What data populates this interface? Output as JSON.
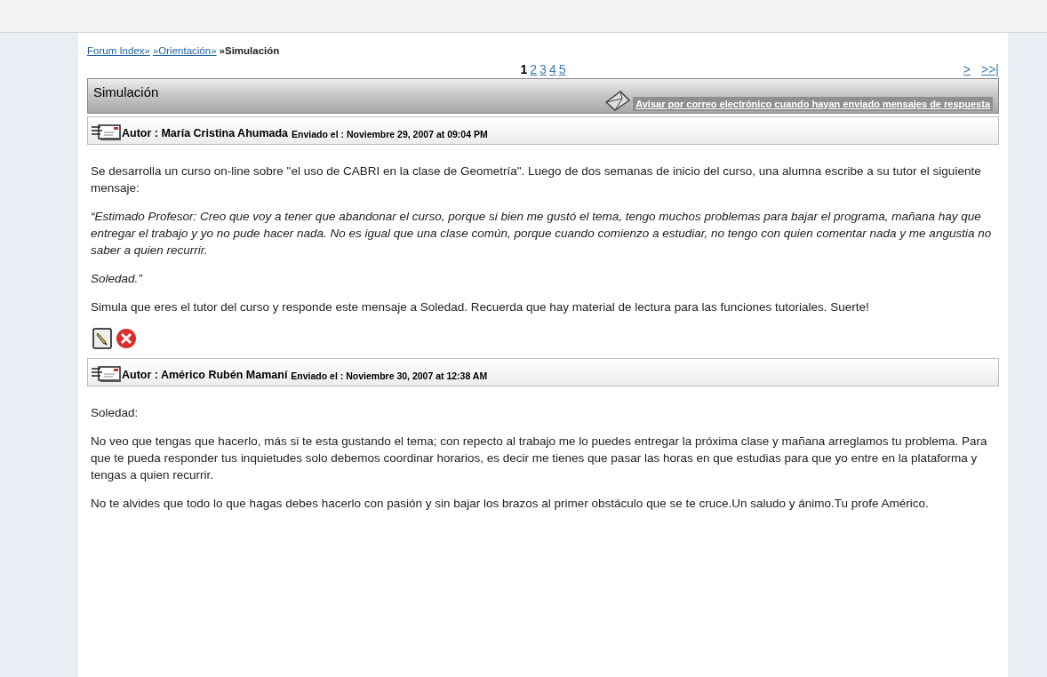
{
  "breadcrumb": [
    {
      "kind": "link",
      "text": "Forum Index»"
    },
    {
      "kind": "link",
      "text": "»Orientación»"
    },
    {
      "kind": "current",
      "text": "»Simulación"
    }
  ],
  "pagination": {
    "pages": [
      {
        "label": "1",
        "selected": true
      },
      {
        "label": "2",
        "selected": false
      },
      {
        "label": "3",
        "selected": false
      },
      {
        "label": "4",
        "selected": false
      },
      {
        "label": "5",
        "selected": false
      }
    ],
    "next": ">",
    "last": ">>|"
  },
  "topic": {
    "title": "Simulación",
    "notify_link": "Avisar por correo electrónico cuando hayan enviado mensajes de respuesta"
  },
  "posts": [
    {
      "author": "Autor : María Cristina Ahumada",
      "sent": "Enviado el : Noviembre 29, 2007 at 09:04 PM",
      "actions": true,
      "paragraphs": [
        {
          "kind": "normal",
          "text": "Se desarrolla un curso on-line sobre \"el uso de CABRI en la clase de Geometría\". Luego de dos semanas de inicio del curso, una alumna escribe a su tutor el siguiente mensaje:"
        },
        {
          "kind": "italic",
          "text": "“Estimado Profesor: Creo que voy a tener que abandonar el curso, porque si bien me gustó el tema, tengo muchos problemas para bajar el programa, mañana hay que entregar el trabajo y yo no pude hacer nada. No es igual que una clase común, porque cuando comienzo a estudiar, no tengo con quien comentar nada y me angustia no saber a quien recurrir."
        },
        {
          "kind": "italic",
          "text": "Soledad.”"
        },
        {
          "kind": "normal",
          "text": "Simula que eres el tutor del curso y responde este mensaje a Soledad. Recuerda que hay material de lectura para las funciones tutoriales. Suerte!"
        }
      ]
    },
    {
      "author": "Autor : Américo Rubén Mamaní",
      "sent": "Enviado el : Noviembre 30, 2007 at 12:38 AM",
      "actions": false,
      "paragraphs": [
        {
          "kind": "normal",
          "text": "Soledad:"
        },
        {
          "kind": "normal",
          "text": "No veo que tengas que hacerlo, más si te esta gustando el tema; con repecto al trabajo me lo puedes entregar la próxima clase y mañana arreglamos tu problema. Para que te pueda responder tus inquietudes solo debemos coordinar horarios, es decir me tienes que pasar las horas en que estudias para que yo entre en la plataforma y tengas a quien recurrir."
        },
        {
          "kind": "normal",
          "text": "No te alvides que todo lo que hagas debes hacerlo con pasión y sin bajar los brazos al primer obstáculo que se te cruce.Un saludo y ánimo.Tu profe Américo."
        }
      ]
    }
  ]
}
